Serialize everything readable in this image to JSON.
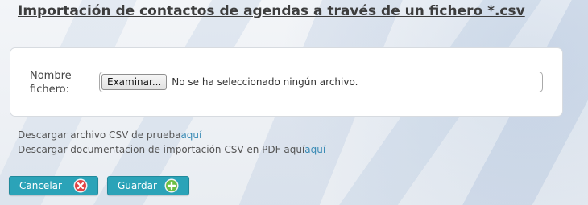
{
  "page": {
    "title": "Importación de contactos de agendas a través de un fichero *.csv"
  },
  "form": {
    "file_label": "Nombre fichero:",
    "browse_button_label": "Examinar...",
    "no_file_text": "No se ha seleccionado ningún archivo."
  },
  "links": {
    "csv_sample_text": "Descargar archivo CSV de prueba",
    "csv_sample_link": "aquí",
    "pdf_doc_text": "Descargar documentacion de importación CSV en PDF aquí",
    "pdf_doc_link": "aquí"
  },
  "buttons": {
    "cancel_label": "Cancelar",
    "cancel_icon": "cancel-x-icon",
    "save_label": "Guardar",
    "save_icon": "plus-icon"
  },
  "colors": {
    "button_bg": "#2ba3b8",
    "link": "#3a8bb5",
    "cancel_icon": "#e04545",
    "save_icon": "#6cbf45"
  }
}
